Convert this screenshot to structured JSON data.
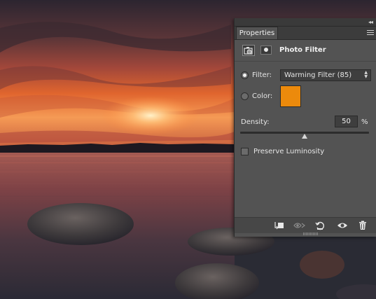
{
  "panel": {
    "tab_label": "Properties",
    "collapse_glyph": "◂◂",
    "title": "Photo Filter",
    "filter_label": "Filter:",
    "filter_value": "Warming Filter (85)",
    "color_label": "Color:",
    "color_hex": "#ec8a0c",
    "density_label": "Density:",
    "density_value": "50",
    "density_unit": "%",
    "density_percent": 50,
    "preserve_label": "Preserve Luminosity",
    "preserve_checked": false,
    "filter_selected": true
  },
  "icons": {
    "adjustment": "camera-filter-icon",
    "mask": "layer-mask-icon",
    "clip": "clip-to-layer-icon",
    "view_previous": "view-previous-state-icon",
    "reset": "reset-icon",
    "visibility": "eye-icon",
    "delete": "trash-icon"
  },
  "colors": {
    "panel_bg": "#535353",
    "accent_orange": "#ec8a0c"
  }
}
